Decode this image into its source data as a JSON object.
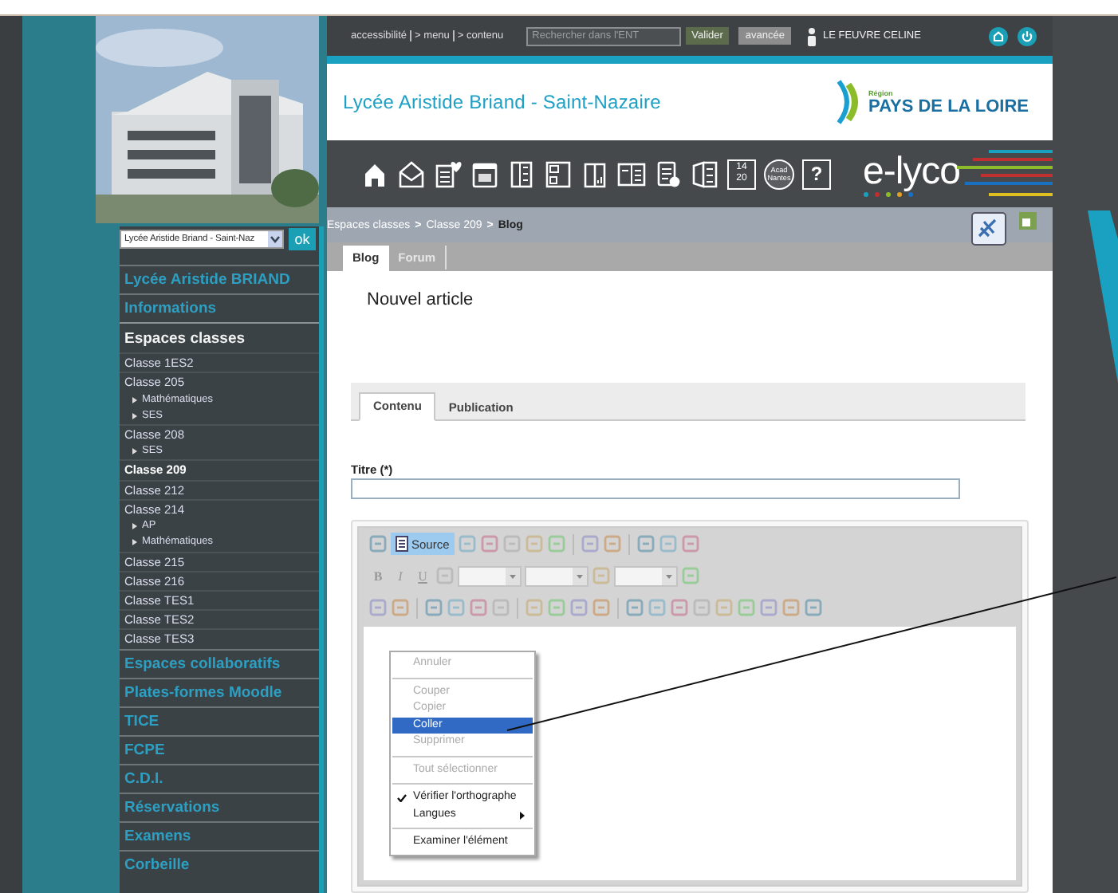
{
  "top_bar": {
    "links": [
      "accessibilité",
      "> menu",
      "> contenu"
    ],
    "search": {
      "placeholder": "Rechercher dans l'ENT"
    },
    "buttons": [
      "Valider",
      "avancée"
    ],
    "user": "LE FEUVRE CELINE"
  },
  "header": {
    "title": "Lycée Aristide Briand - Saint-Nazaire",
    "logo": {
      "region": "Région",
      "name": "PAYS DE LA LOIRE"
    }
  },
  "app_bar": {
    "icons": [
      {
        "kind": "home"
      },
      {
        "kind": "mail"
      },
      {
        "kind": "note"
      },
      {
        "kind": "calendar"
      },
      {
        "kind": "binder"
      },
      {
        "kind": "page"
      },
      {
        "kind": "book"
      },
      {
        "kind": "notebook"
      },
      {
        "kind": "checklist"
      },
      {
        "kind": "folder"
      },
      {
        "kind": "grades",
        "lines": [
          "14",
          "20"
        ]
      },
      {
        "kind": "academy",
        "lines": [
          "Acad",
          "Nantes"
        ]
      },
      {
        "kind": "help",
        "lines": [
          "?"
        ]
      }
    ],
    "logo": "e-lyco"
  },
  "sidebar": {
    "school_select": {
      "value": "Lycée Aristide Briand - Saint-Naz"
    },
    "ok_button": "ok",
    "menu": [
      {
        "kind": "section",
        "label": "Lycée Aristide BRIAND"
      },
      {
        "kind": "section",
        "label": "Informations"
      },
      {
        "kind": "heading",
        "label": "Espaces classes"
      },
      {
        "kind": "class",
        "label": "Classe 1ES2",
        "selected": false
      },
      {
        "kind": "class",
        "label": "Classe 205",
        "selected": false,
        "children": [
          {
            "label": "Mathématiques"
          },
          {
            "label": "SES"
          }
        ]
      },
      {
        "kind": "class",
        "label": "Classe 208",
        "selected": false,
        "children": [
          {
            "label": "SES"
          }
        ]
      },
      {
        "kind": "class",
        "label": "Classe 209",
        "selected": true
      },
      {
        "kind": "class",
        "label": "Classe 212",
        "selected": false
      },
      {
        "kind": "class",
        "label": "Classe 214",
        "selected": false,
        "children": [
          {
            "label": "AP"
          },
          {
            "label": "Mathématiques"
          }
        ]
      },
      {
        "kind": "class",
        "label": "Classe 215",
        "selected": false
      },
      {
        "kind": "class",
        "label": "Classe 216",
        "selected": false
      },
      {
        "kind": "class",
        "label": "Classe TES1",
        "selected": false
      },
      {
        "kind": "class",
        "label": "Classe TES2",
        "selected": false
      },
      {
        "kind": "class",
        "label": "Classe TES3",
        "selected": false
      },
      {
        "kind": "section",
        "label": "Espaces collaboratifs"
      },
      {
        "kind": "section",
        "label": "Plates-formes Moodle"
      },
      {
        "kind": "section",
        "label": "TICE"
      },
      {
        "kind": "section",
        "label": "FCPE"
      },
      {
        "kind": "section",
        "label": "C.D.I."
      },
      {
        "kind": "section",
        "label": "Réservations"
      },
      {
        "kind": "section",
        "label": "Examens"
      },
      {
        "kind": "section",
        "label": "Corbeille"
      }
    ]
  },
  "breadcrumb": [
    {
      "kind": "link",
      "label": "Espaces classes"
    },
    {
      "kind": "separator",
      "label": ">"
    },
    {
      "kind": "link",
      "label": "Classe 209"
    },
    {
      "kind": "separator",
      "label": ">"
    },
    {
      "kind": "current",
      "label": "Blog"
    }
  ],
  "tabs": [
    {
      "label": "Blog",
      "selected": true
    },
    {
      "label": "Forum",
      "selected": false
    }
  ],
  "content": {
    "heading": "Nouvel article",
    "tabs": [
      {
        "label": "Contenu",
        "selected": true
      },
      {
        "label": "Publication",
        "selected": false
      }
    ],
    "title_field": {
      "label": "Titre (*)"
    },
    "editor": {
      "toolbar_rows": [
        [
          {
            "kind": "icon"
          },
          {
            "kind": "source",
            "label": "Source",
            "pressed": true
          },
          {
            "kind": "icon"
          },
          {
            "kind": "icon"
          },
          {
            "kind": "icon"
          },
          {
            "kind": "icon"
          },
          {
            "kind": "icon"
          },
          {
            "kind": "sep"
          },
          {
            "kind": "icon"
          },
          {
            "kind": "icon"
          },
          {
            "kind": "sep"
          },
          {
            "kind": "icon"
          },
          {
            "kind": "icon"
          },
          {
            "kind": "icon"
          }
        ],
        [
          {
            "kind": "text",
            "label": "B",
            "pressed": false
          },
          {
            "kind": "text",
            "label": "I",
            "pressed": false
          },
          {
            "kind": "text",
            "label": "U",
            "pressed": false
          },
          {
            "kind": "icon"
          },
          {
            "kind": "select"
          },
          {
            "kind": "select"
          },
          {
            "kind": "icon"
          },
          {
            "kind": "select"
          },
          {
            "kind": "icon"
          }
        ],
        [
          {
            "kind": "icon"
          },
          {
            "kind": "icon"
          },
          {
            "kind": "sep"
          },
          {
            "kind": "icon"
          },
          {
            "kind": "icon"
          },
          {
            "kind": "icon"
          },
          {
            "kind": "icon"
          },
          {
            "kind": "sep"
          },
          {
            "kind": "icon"
          },
          {
            "kind": "icon"
          },
          {
            "kind": "icon"
          },
          {
            "kind": "icon"
          },
          {
            "kind": "sep"
          },
          {
            "kind": "icon"
          },
          {
            "kind": "icon"
          },
          {
            "kind": "icon"
          },
          {
            "kind": "icon"
          },
          {
            "kind": "icon"
          },
          {
            "kind": "icon"
          },
          {
            "kind": "icon"
          },
          {
            "kind": "icon"
          },
          {
            "kind": "icon"
          }
        ]
      ],
      "context_menu": [
        {
          "label": "Annuler",
          "disabled": true,
          "selected": false,
          "checked": false,
          "submenu": false,
          "separator_before": false
        },
        {
          "label": "Couper",
          "disabled": true,
          "selected": false,
          "checked": false,
          "submenu": false,
          "separator_before": true
        },
        {
          "label": "Copier",
          "disabled": true,
          "selected": false,
          "checked": false,
          "submenu": false,
          "separator_before": false
        },
        {
          "label": "Coller",
          "disabled": false,
          "selected": true,
          "checked": false,
          "submenu": false,
          "separator_before": false
        },
        {
          "label": "Supprimer",
          "disabled": true,
          "selected": false,
          "checked": false,
          "submenu": false,
          "separator_before": false
        },
        {
          "label": "Tout sélectionner",
          "disabled": true,
          "selected": false,
          "checked": false,
          "submenu": false,
          "separator_before": true
        },
        {
          "label": "Vérifier l'orthographe",
          "disabled": false,
          "selected": false,
          "checked": true,
          "submenu": false,
          "separator_before": true
        },
        {
          "label": "Langues",
          "disabled": false,
          "selected": false,
          "checked": false,
          "submenu": true,
          "separator_before": false
        },
        {
          "label": "Examiner l'élément",
          "disabled": false,
          "selected": false,
          "checked": false,
          "submenu": false,
          "separator_before": true
        }
      ]
    }
  }
}
